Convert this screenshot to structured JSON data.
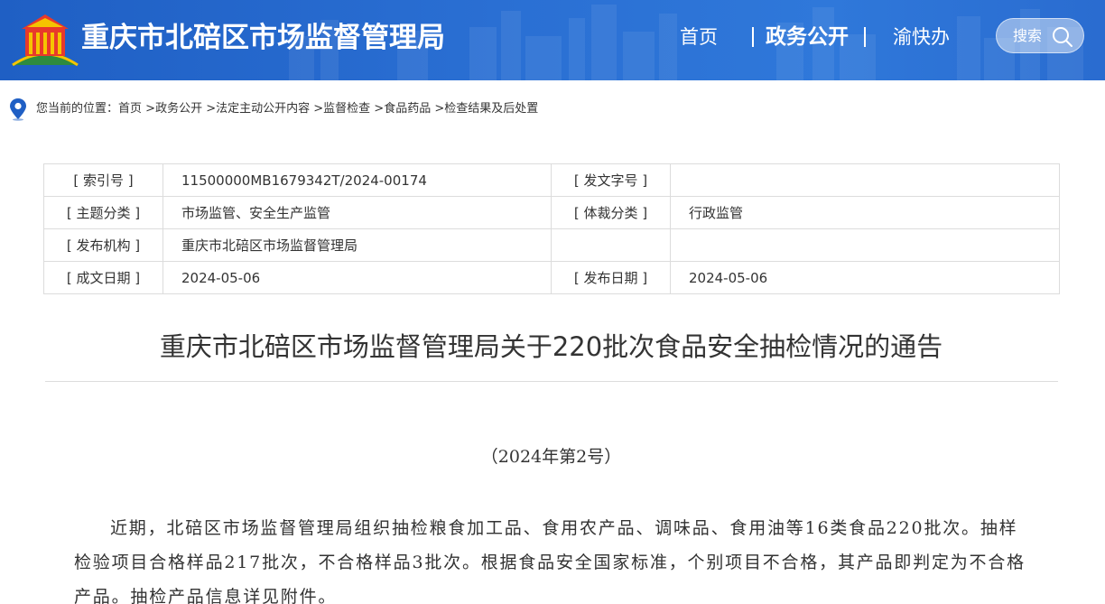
{
  "header": {
    "site_title": "重庆市北碚区市场监督管理局",
    "nav": {
      "home": "首页",
      "open_gov": "政务公开",
      "yu_kuai_ban": "渝快办"
    },
    "search_label": "搜索",
    "colors": {
      "primary": "#2a6fd3",
      "text": "#ffffff"
    }
  },
  "breadcrumb": {
    "prefix": "您当前的位置：",
    "items": [
      "首页",
      "政务公开",
      "法定主动公开内容",
      "监督检查",
      "食品药品",
      "检查结果及后处置"
    ],
    "separator": " >"
  },
  "info": {
    "index_no_label": "[ 索引号 ]",
    "index_no_value": "11500000MB1679342T/2024-00174",
    "doc_no_label": "[ 发文字号 ]",
    "doc_no_value": "",
    "subject_label": "[ 主题分类 ]",
    "subject_value": "市场监管、安全生产监管",
    "genre_label": "[ 体裁分类 ]",
    "genre_value": "行政监管",
    "issuer_label": "[ 发布机构 ]",
    "issuer_value": "重庆市北碚区市场监督管理局",
    "created_label": "[ 成文日期 ]",
    "created_value": "2024-05-06",
    "published_label": "[ 发布日期 ]",
    "published_value": "2024-05-06"
  },
  "article": {
    "title": "重庆市北碚区市场监督管理局关于220批次食品安全抽检情况的通告",
    "doc_number": "（2024年第2号）",
    "paragraph_1": "近期，北碚区市场监督管理局组织抽检粮食加工品、食用农产品、调味品、食用油等16类食品220批次。抽样检验项目合格样品217批次，不合格样品3批次。根据食品安全国家标准，个别项目不合格，其产品即判定为不合格产品。抽检产品信息详见附件。"
  }
}
